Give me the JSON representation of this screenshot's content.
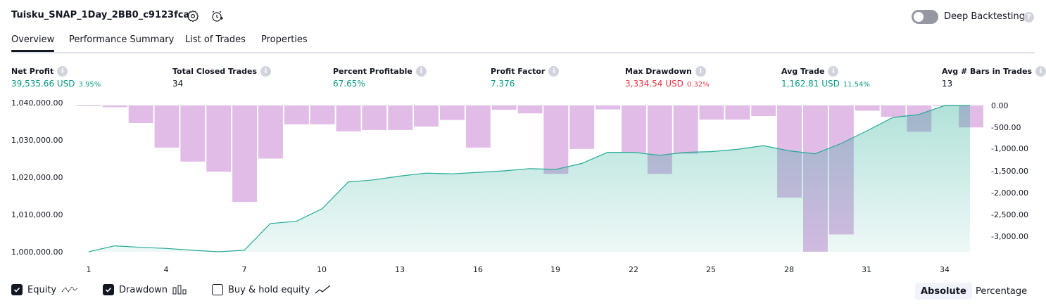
{
  "header": {
    "strategy_title": "Tuisku_SNAP_1Day_2BB0_c9123fca",
    "deep_backtesting_label": "Deep Backtesting",
    "deep_backtesting_enabled": false
  },
  "tabs": [
    {
      "label": "Overview",
      "active": true
    },
    {
      "label": "Performance Summary",
      "active": false
    },
    {
      "label": "List of Trades",
      "active": false
    },
    {
      "label": "Properties",
      "active": false
    }
  ],
  "metrics": [
    {
      "label": "Net Profit",
      "value": "39,535.66 USD",
      "pct": "3.95%",
      "tone": "green"
    },
    {
      "label": "Total Closed Trades",
      "value": "34",
      "pct": "",
      "tone": "neutral"
    },
    {
      "label": "Percent Profitable",
      "value": "67.65%",
      "pct": "",
      "tone": "green"
    },
    {
      "label": "Profit Factor",
      "value": "7.376",
      "pct": "",
      "tone": "green"
    },
    {
      "label": "Max Drawdown",
      "value": "3,334.54 USD",
      "pct": "0.32%",
      "tone": "red"
    },
    {
      "label": "Avg Trade",
      "value": "1,162.81 USD",
      "pct": "11.54%",
      "tone": "green"
    },
    {
      "label": "Avg # Bars in Trades",
      "value": "13",
      "pct": "",
      "tone": "neutral"
    }
  ],
  "chart_data": {
    "type": "area",
    "x_ticks": [
      "1",
      "4",
      "7",
      "10",
      "13",
      "16",
      "19",
      "22",
      "25",
      "28",
      "31",
      "34"
    ],
    "left_axis": {
      "ticks": [
        "1,040,000.00",
        "1,030,000.00",
        "1,020,000.00",
        "1,010,000.00",
        "1,000,000.00"
      ],
      "range": [
        1000000,
        1040000
      ]
    },
    "right_axis": {
      "ticks": [
        "0.00",
        "-500.00",
        "-1,000.00",
        "-1,500.00",
        "-2,000.00",
        "-2,500.00",
        "-3,000.00"
      ],
      "range": [
        -3334.54,
        0
      ]
    },
    "x": [
      1,
      2,
      3,
      4,
      5,
      6,
      7,
      8,
      9,
      10,
      11,
      12,
      13,
      14,
      15,
      16,
      17,
      18,
      19,
      20,
      21,
      22,
      23,
      24,
      25,
      26,
      27,
      28,
      29,
      30,
      31,
      32,
      33,
      34,
      35
    ],
    "series": [
      {
        "name": "Equity",
        "color": "#22ab94",
        "values": [
          1000000,
          1001600,
          1001200,
          1000900,
          1000400,
          1000000,
          1000400,
          1007600,
          1008200,
          1011600,
          1018800,
          1019400,
          1020400,
          1021200,
          1021000,
          1021400,
          1021800,
          1022400,
          1022200,
          1023800,
          1026800,
          1026800,
          1026000,
          1026800,
          1027000,
          1027600,
          1028600,
          1027200,
          1026400,
          1029200,
          1032600,
          1036200,
          1037000,
          1041500,
          1041800
        ],
        "ylim": [
          1000000,
          1040000
        ]
      },
      {
        "name": "Drawdown",
        "color": "#ce93d8",
        "values": [
          0,
          -40,
          -400,
          -960,
          -1280,
          -1510,
          -2200,
          -1210,
          -430,
          -430,
          -590,
          -560,
          -560,
          -480,
          -330,
          -960,
          -100,
          -180,
          -1560,
          -990,
          -90,
          -1080,
          -1560,
          -1100,
          -320,
          -320,
          -240,
          -2100,
          -3334.54,
          -2940,
          -120,
          -260,
          -600,
          0,
          -500
        ],
        "ylim": [
          -3334.54,
          0
        ]
      }
    ],
    "legend": "bottom-left"
  },
  "legend": {
    "items": [
      {
        "label": "Equity",
        "checked": true,
        "icon": "equity-line-icon"
      },
      {
        "label": "Drawdown",
        "checked": true,
        "icon": "drawdown-bars-icon"
      },
      {
        "label": "Buy & hold equity",
        "checked": false,
        "icon": "buy-hold-line-icon"
      }
    ],
    "mode_absolute": "Absolute",
    "mode_percentage": "Percentage",
    "active_mode": "Absolute"
  }
}
